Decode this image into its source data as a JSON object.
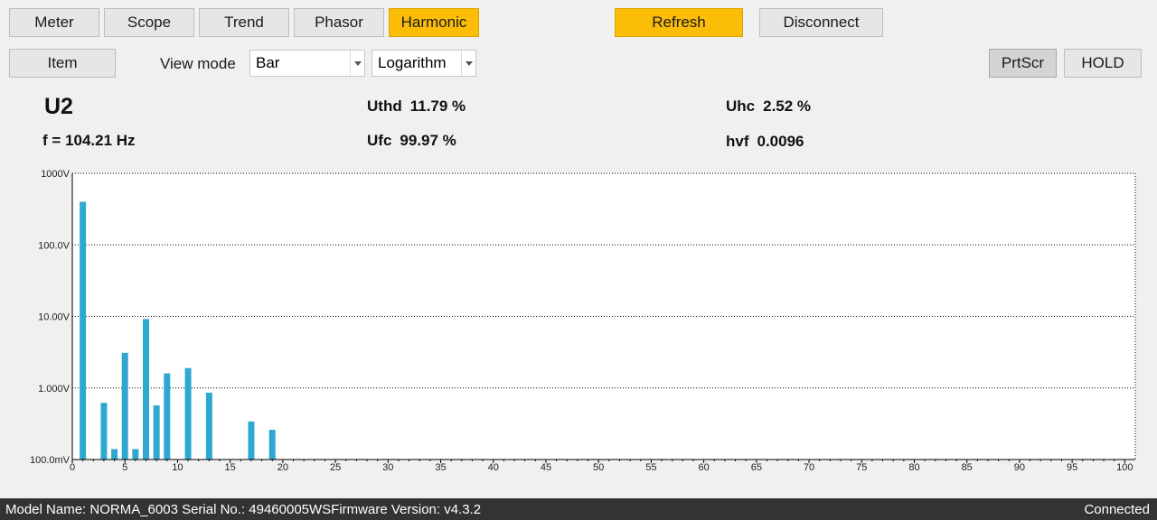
{
  "tabs": [
    {
      "label": "Meter",
      "active": false
    },
    {
      "label": "Scope",
      "active": false
    },
    {
      "label": "Trend",
      "active": false
    },
    {
      "label": "Phasor",
      "active": false
    },
    {
      "label": "Harmonic",
      "active": true
    }
  ],
  "toolbar": {
    "refresh_label": "Refresh",
    "disconnect_label": "Disconnect",
    "item_label": "Item",
    "view_mode_label": "View mode",
    "view_mode_value": "Bar",
    "scale_value": "Logarithm",
    "prtscr_label": "PrtScr",
    "hold_label": "HOLD"
  },
  "measurement": {
    "channel": "U2",
    "freq_label": "f = 104.21 Hz",
    "uthd_label": "Uthd",
    "uthd_value": "11.79 %",
    "ufc_label": "Ufc",
    "ufc_value": "99.97 %",
    "uhc_label": "Uhc",
    "uhc_value": "2.52 %",
    "hvf_label": "hvf",
    "hvf_value": "0.0096"
  },
  "chart_data": {
    "type": "bar",
    "yscale": "log",
    "ylim_volts": [
      0.1,
      1000
    ],
    "y_tick_labels": [
      "1000V",
      "100.0V",
      "10.00V",
      "1.000V",
      "100.0mV"
    ],
    "xlim": [
      0,
      101
    ],
    "x_tick_labels": [
      "0",
      "5",
      "10",
      "15",
      "20",
      "25",
      "30",
      "35",
      "40",
      "45",
      "50",
      "55",
      "60",
      "65",
      "70",
      "75",
      "80",
      "85",
      "90",
      "95",
      "100"
    ],
    "bars": [
      {
        "order": 1,
        "volts": 400
      },
      {
        "order": 3,
        "volts": 0.62
      },
      {
        "order": 4,
        "volts": 0.14
      },
      {
        "order": 5,
        "volts": 3.1
      },
      {
        "order": 6,
        "volts": 0.14
      },
      {
        "order": 7,
        "volts": 9.2
      },
      {
        "order": 8,
        "volts": 0.57
      },
      {
        "order": 9,
        "volts": 1.6
      },
      {
        "order": 11,
        "volts": 1.9
      },
      {
        "order": 13,
        "volts": 0.86
      },
      {
        "order": 17,
        "volts": 0.34
      },
      {
        "order": 19,
        "volts": 0.26
      }
    ],
    "bar_color": "#2fa8d0",
    "grid": true
  },
  "status_bar": {
    "device_info": "Model Name:  NORMA_6003 Serial No.:  49460005WSFirmware Version:  v4.3.2",
    "connection": "Connected"
  }
}
